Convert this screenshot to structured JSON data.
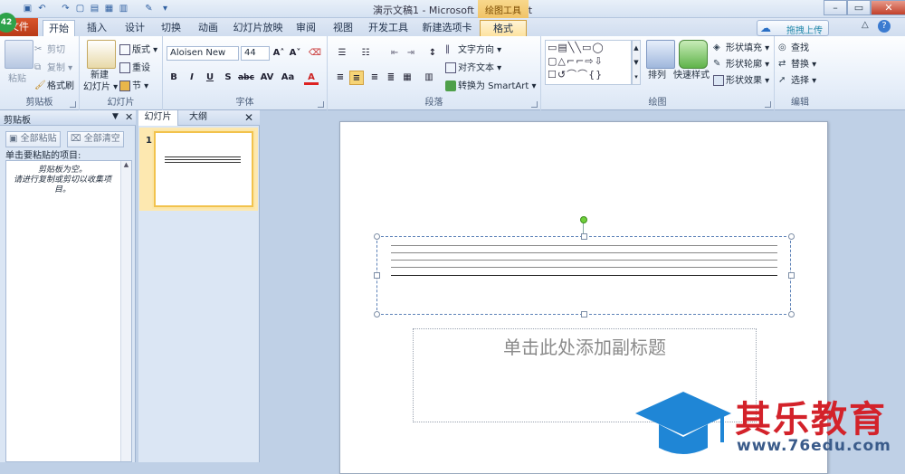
{
  "titlebar": {
    "title": "演示文稿1 - Microsoft PowerPoint",
    "badge": "42"
  },
  "tabs": {
    "file": "文件",
    "items": [
      "开始",
      "插入",
      "设计",
      "切换",
      "动画",
      "幻灯片放映",
      "审阅",
      "视图",
      "开发工具",
      "新建选项卡"
    ],
    "context_group": "绘图工具",
    "context_tab": "格式",
    "upload": "拖拽上传"
  },
  "ribbon": {
    "clipboard": {
      "label": "剪贴板",
      "paste": "粘贴",
      "cut": "剪切",
      "copy": "复制",
      "format_painter": "格式刷"
    },
    "slides": {
      "label": "幻灯片",
      "new_slide_1": "新建",
      "new_slide_2": "幻灯片",
      "layout": "版式",
      "reset": "重设",
      "section": "节"
    },
    "font": {
      "label": "字体",
      "font_name": "Aloisen New",
      "font_size": "44",
      "bold": "B",
      "italic": "I",
      "underline": "U",
      "shadow": "S",
      "strike": "abc",
      "spacing": "AV",
      "case": "Aa",
      "color": "A"
    },
    "paragraph": {
      "label": "段落",
      "text_direction": "文字方向",
      "align_text": "对齐文本",
      "smartart": "转换为 SmartArt"
    },
    "drawing": {
      "label": "绘图",
      "arrange": "排列",
      "quick_styles": "快速样式",
      "shape_fill": "形状填充",
      "shape_outline": "形状轮廓",
      "shape_effects": "形状效果"
    },
    "editing": {
      "label": "编辑",
      "find": "查找",
      "replace": "替换",
      "select": "选择"
    }
  },
  "clipboard_pane": {
    "title": "剪贴板",
    "paste_all": "全部粘贴",
    "clear_all": "全部清空",
    "instruction": "单击要粘贴的项目:",
    "empty_1": "剪贴板为空。",
    "empty_2": "请进行复制或剪切以收集项目。"
  },
  "slides_pane": {
    "tab_slides": "幻灯片",
    "tab_outline": "大纲",
    "slide_number": "1"
  },
  "slide": {
    "subtitle_placeholder": "单击此处添加副标题"
  },
  "watermark": {
    "name": "其乐教育",
    "url": "www.76edu.com"
  },
  "colors": {
    "accent": "#2a6fc5",
    "file_tab": "#c8461f",
    "context": "#f2c766",
    "watermark_red": "#d3222a"
  }
}
